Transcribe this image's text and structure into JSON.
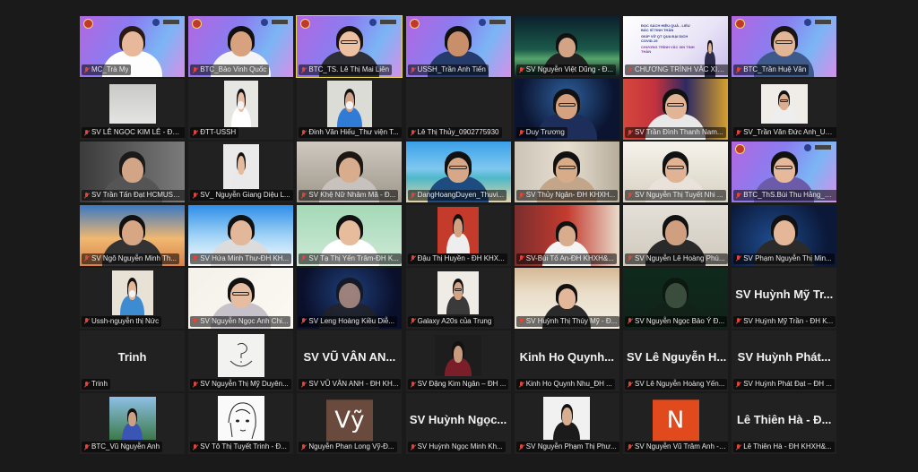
{
  "meeting": {
    "rows": [
      [
        {
          "name": "MC_Trà My"
        },
        {
          "name": "BTC_Bảo Vinh Quốc"
        },
        {
          "name": "BTC_TS. Lê Thị Mai Liên",
          "active": true
        },
        {
          "name": "USSH_Trần Anh Tiến"
        },
        {
          "name": "SV Nguyễn Việt Dũng - Đ..."
        },
        {
          "name": "CHƯƠNG TRÌNH VĂC XIN..."
        },
        {
          "name": "BTC_Trần Huệ Vân"
        }
      ],
      [
        {
          "name": "SV LÊ NGỌC KIM LÊ - ĐH ..."
        },
        {
          "name": "ĐTT-USSH"
        },
        {
          "name": "Đinh Văn Hiếu_Thư viện T..."
        },
        {
          "name": "Lê Thị Thủy_0902775930"
        },
        {
          "name": "Duy Trương"
        },
        {
          "name": "SV Trần Đình Thanh Nam..."
        },
        {
          "name": "SV_Trần Văn Đức Anh_US..."
        }
      ],
      [
        {
          "name": "SV Trần Tấn Đạt HCMUSS..."
        },
        {
          "name": "SV_ Nguyễn Giang Diệu L..."
        },
        {
          "name": "SV Khệ Nữ Nhâm Mã - Đ..."
        },
        {
          "name": "DangHoangDuyen_Thuvi..."
        },
        {
          "name": "SV Thủy Ngân- ĐH KHXH..."
        },
        {
          "name": "SV Nguyễn Thị Tuyết Nhi ..."
        },
        {
          "name": "BTC_ThS.Bùi Thu Hằng_Th..."
        }
      ],
      [
        {
          "name": "SV Ngô Nguyễn Minh Th..."
        },
        {
          "name": "SV Hứa Minh Thư-ĐH KH..."
        },
        {
          "name": "SV Tạ Thị Yến Trâm-ĐH K..."
        },
        {
          "name": "Đậu Thị Huyền - ĐH KHX..."
        },
        {
          "name": "SV-Bùi Tố An-ĐH KHXH&..."
        },
        {
          "name": "SV Nguyễn Lê Hoàng Phú..."
        },
        {
          "name": "SV Phạm Nguyễn Thị Min..."
        }
      ],
      [
        {
          "name": "Ussh-nguyễn thị Nức"
        },
        {
          "name": "SV Nguyễn Ngọc Anh Chi..."
        },
        {
          "name": "SV Leng Hoàng Kiều Diễ..."
        },
        {
          "name": "Galaxy A20s của Trung"
        },
        {
          "name": "SV Huỳnh Thị Thúy Mỹ - Đ..."
        },
        {
          "name": "SV Nguyễn Ngọc Bảo Ý Đ..."
        },
        {
          "name": "SV Huỳnh Mỹ Trần - ĐH K...",
          "display": "SV Huỳnh Mỹ Tr..."
        }
      ],
      [
        {
          "name": "Trinh",
          "display": "Trinh"
        },
        {
          "name": "SV Nguyễn Thị Mỹ Duyên..."
        },
        {
          "name": "SV VŨ VÂN ANH - ĐH KH...",
          "display": "SV VŨ VÂN AN..."
        },
        {
          "name": "SV Đặng Kim Ngân – ĐH ..."
        },
        {
          "name": "Kinh Ho Quynh Nhu_ĐH ...",
          "display": "Kinh Ho Quynh..."
        },
        {
          "name": "SV Lê Nguyễn Hoàng Yến...",
          "display": "SV Lê Nguyễn H..."
        },
        {
          "name": "SV Huỳnh Phát Đạt – ĐH ...",
          "display": "SV Huỳnh Phát..."
        }
      ],
      [
        {
          "name": "BTC_Vũ Nguyễn Anh"
        },
        {
          "name": "SV Tô Thị Tuyết Trinh - Đ..."
        },
        {
          "name": "Nguyễn Phan Long Vỹ-Đ...",
          "avatar_letter": "Vỹ"
        },
        {
          "name": "SV Huỳnh Ngọc Minh Kh...",
          "display": "SV Huỳnh Ngọc..."
        },
        {
          "name": "SV Nguyễn Phạm Thị Phư..."
        },
        {
          "name": "SV Nguyễn Vũ Trâm Anh - Đ...",
          "avatar_letter": "N"
        },
        {
          "name": "Lê Thiên Hà - ĐH KHXH&...",
          "display": "Lê Thiên Hà - Đ..."
        }
      ]
    ],
    "banner_text": {
      "line1": "ĐỌC SÁCH HIỆU QUẢ - LIỀU BẮC SĨ TINH THẦN",
      "line2": "GIÚP VỮ QT QUA ĐẠI DỊCH COVID-19",
      "line3": "CHƯƠNG TRÌNH VĂC XIN TINH THẦN"
    },
    "colors": {
      "background": "#1a1a1a",
      "tile": "#212121",
      "active_border": "#e8d64a",
      "muted_mic": "#e0453a",
      "avatar_vy": "#6b4a3e",
      "avatar_n": "#e04a1c"
    }
  }
}
